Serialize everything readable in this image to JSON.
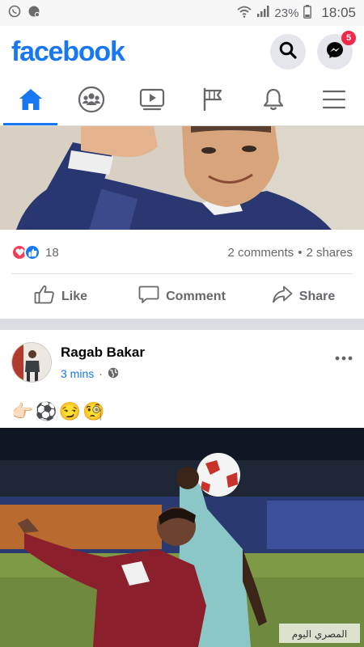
{
  "status_bar": {
    "battery": "23%",
    "time": "18:05",
    "icons": [
      "whatsapp-icon",
      "notification-icon",
      "wifi-icon",
      "signal-icon",
      "battery-icon"
    ]
  },
  "header": {
    "logo": "facebook",
    "messenger_badge": "5"
  },
  "nav": {
    "tabs": [
      "home",
      "groups",
      "watch",
      "pages",
      "notifications",
      "menu"
    ],
    "active": "home"
  },
  "post1": {
    "reaction_count": "18",
    "comments": "2 comments",
    "separator": "•",
    "shares": "2 shares",
    "actions": {
      "like": "Like",
      "comment": "Comment",
      "share": "Share"
    }
  },
  "post2": {
    "author": "Ragab Bakar",
    "time": "3 mins",
    "dot": "·",
    "text_emojis": [
      "👉🏻",
      "⚽",
      "😏",
      "🧐"
    ],
    "watermark": "المصري اليوم"
  },
  "colors": {
    "brand": "#1877f2",
    "badge": "#f02849",
    "love": "#f33e58",
    "like": "#1877f2"
  }
}
